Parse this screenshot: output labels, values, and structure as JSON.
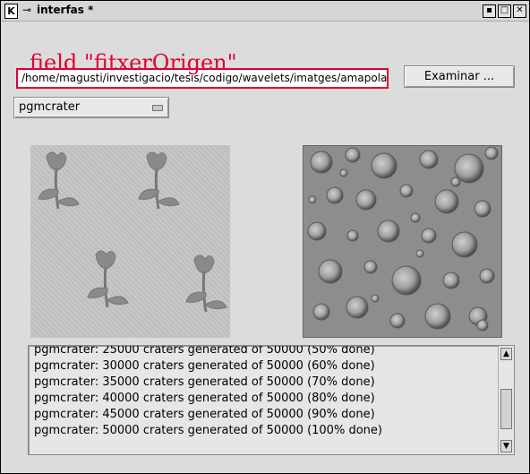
{
  "window": {
    "title": "interfas *",
    "controls": [
      "minimize",
      "maximize",
      "close"
    ]
  },
  "overlay": {
    "label": "field \"fitxerOrigen\""
  },
  "file_field": {
    "value": "/home/magusti/investigacio/tesis/codigo/wavelets/imatges/amapola"
  },
  "examinar_button": {
    "label": "Examinar ..."
  },
  "generator_select": {
    "value": "pgmcrater"
  },
  "log": {
    "lines": [
      "pgmcrater: 25000 craters generated of 50000 (50% done)",
      "pgmcrater: 30000 craters generated of 50000 (60% done)",
      "pgmcrater: 35000 craters generated of 50000 (70% done)",
      "pgmcrater: 40000 craters generated of 50000 (80% done)",
      "pgmcrater: 45000 craters generated of 50000 (90% done)",
      "pgmcrater: 50000 craters generated of 50000 (100% done)"
    ]
  },
  "colors": {
    "highlight": "#e00036",
    "background": "#dcdcdc"
  }
}
